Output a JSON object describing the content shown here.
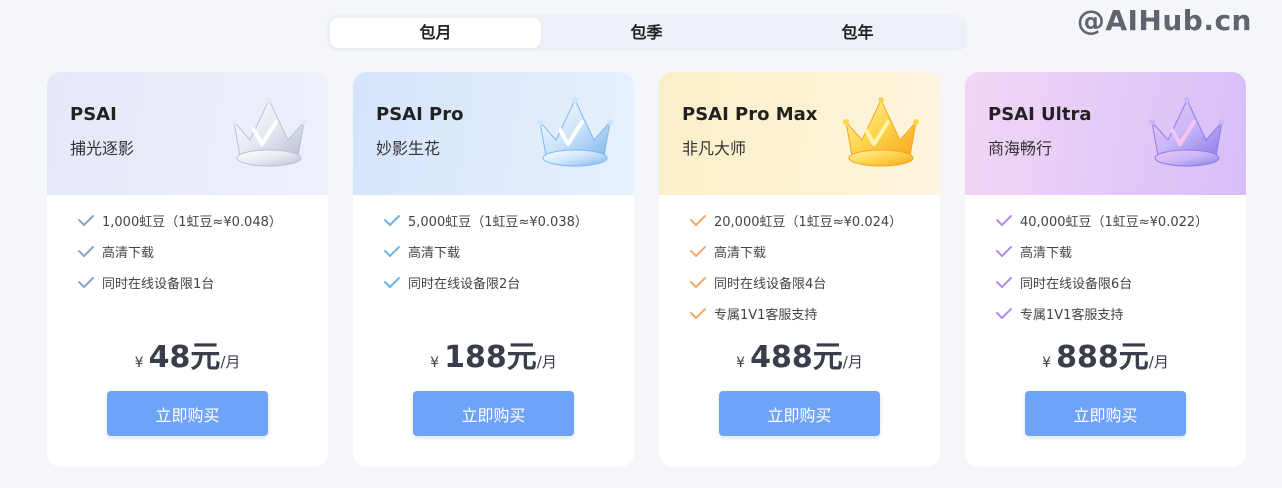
{
  "watermark": "@AIHub.cn",
  "tabs": [
    {
      "label": "包月",
      "active": true
    },
    {
      "label": "包季",
      "active": false
    },
    {
      "label": "包年",
      "active": false
    }
  ],
  "plans": [
    {
      "name": "PSAI",
      "subtitle": "捕光逐影",
      "theme": {
        "head_from": "#e4e8f7",
        "head_to": "#eef0fb",
        "check": "#8aa3c9",
        "crown_a": "#e8eaf2",
        "crown_b": "#b9c0d6",
        "crown_c": "#ffffff"
      },
      "features": [
        "1,000虹豆（1虹豆≈¥0.048）",
        "高清下载",
        "同时在线设备限1台"
      ],
      "price": {
        "symbol": "¥",
        "amount": "48元",
        "unit": "/月"
      },
      "button": "立即购买"
    },
    {
      "name": "PSAI Pro",
      "subtitle": "妙影生花",
      "theme": {
        "head_from": "#d5e4fb",
        "head_to": "#e7f0fd",
        "check": "#6fb3e6",
        "crown_a": "#cfe5fb",
        "crown_b": "#7fb8ee",
        "crown_c": "#ffffff"
      },
      "features": [
        "5,000虹豆（1虹豆≈¥0.038）",
        "高清下载",
        "同时在线设备限2台"
      ],
      "price": {
        "symbol": "¥",
        "amount": "188元",
        "unit": "/月"
      },
      "button": "立即购买"
    },
    {
      "name": "PSAI Pro Max",
      "subtitle": "非凡大师",
      "theme": {
        "head_from": "#fbefc8",
        "head_to": "#fdf5de",
        "check": "#f0aa6a",
        "crown_a": "#ffd54a",
        "crown_b": "#f5a623",
        "crown_c": "#fff3b0"
      },
      "features": [
        "20,000虹豆（1虹豆≈¥0.024）",
        "高清下载",
        "同时在线设备限4台",
        "专属1V1客服支持"
      ],
      "price": {
        "symbol": "¥",
        "amount": "488元",
        "unit": "/月"
      },
      "button": "立即购买"
    },
    {
      "name": "PSAI Ultra",
      "subtitle": "商海畅行",
      "theme": {
        "head_from": "#f3d6f5",
        "head_to": "#d7bef8",
        "check": "#b58af0",
        "crown_a": "#c9b8f7",
        "crown_b": "#8c7de8",
        "crown_c": "#f6c4ee"
      },
      "features": [
        "40,000虹豆（1虹豆≈¥0.022）",
        "高清下载",
        "同时在线设备限6台",
        "专属1V1客服支持"
      ],
      "price": {
        "symbol": "¥",
        "amount": "888元",
        "unit": "/月"
      },
      "button": "立即购买"
    }
  ]
}
